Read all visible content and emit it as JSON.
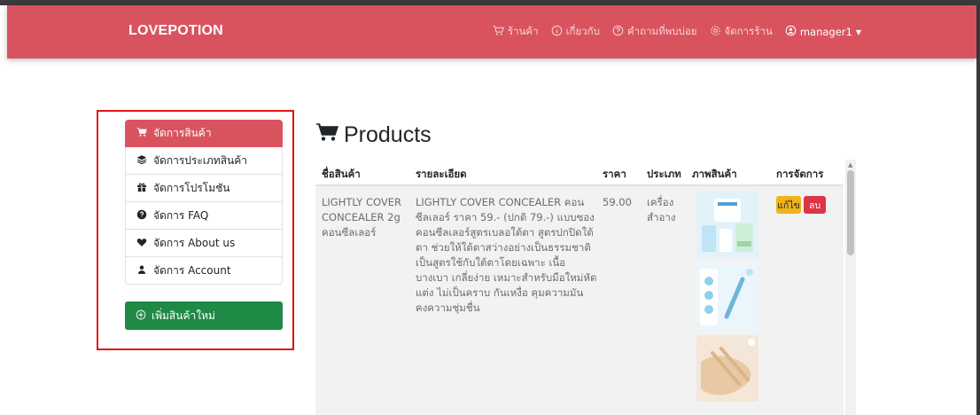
{
  "navbar": {
    "brand": "LOVEPOTION",
    "links": [
      {
        "label": "ร้านค้า",
        "icon": "cart-icon"
      },
      {
        "label": "เกี่ยวกับ",
        "icon": "info-icon"
      },
      {
        "label": "คำถามที่พบบ่อย",
        "icon": "question-icon"
      },
      {
        "label": "จัดการร้าน",
        "icon": "gear-icon"
      }
    ],
    "user": {
      "label": "manager1",
      "icon": "user-circle-icon"
    }
  },
  "sidebar": {
    "items": [
      {
        "label": "จัดการสินค้า",
        "icon": "cart-icon",
        "active": true
      },
      {
        "label": "จัดการประเภทสินค้า",
        "icon": "layers-icon"
      },
      {
        "label": "จัดการโปรโมชัน",
        "icon": "gift-icon"
      },
      {
        "label": "จัดการ FAQ",
        "icon": "question-icon"
      },
      {
        "label": "จัดการ About us",
        "icon": "heart-icon"
      },
      {
        "label": "จัดการ Account",
        "icon": "user-icon"
      }
    ],
    "add_button": "เพิ่มสินค้าใหม่"
  },
  "main": {
    "title": "Products",
    "table": {
      "headers": [
        "ชื่อสินค้า",
        "รายละเอียด",
        "ราคา",
        "ประเภท",
        "ภาพสินค้า",
        "การจัดการ"
      ],
      "rows": [
        {
          "name": "LIGHTLY COVER CONCEALER 2g คอนซีลเลอร์",
          "description": "LIGHTLY COVER CONCEALER คอนซีลเลอร์ ราคา 59.- (ปกติ 79.-) แบบซองคอนซีลเลอร์สูตรเบลอใต้ตา สูตรปกปิดใต้ตา ช่วยให้ใต้ตาสว่างอย่างเป็นธรรมชาติ เป็นสูตรใช้กับใต้ตาโดยเฉพาะ เนื้อบางเบา เกลี่ยง่าย เหมาะสำหรับมือใหม่หัดแต่ง ไม่เป็นคราบ กันเหงื่อ คุมความมัน คงความชุ่มชื่น",
          "price": "59.00",
          "category": "เครื่องสำอาง",
          "edit": "แก้ไข",
          "delete": "ลบ"
        }
      ]
    }
  },
  "colors": {
    "navbar": "#d9535f",
    "active": "#d9535f",
    "add_button": "#1e8a45",
    "edit": "#f0b418",
    "delete": "#dc3545",
    "highlight": "#e01414"
  }
}
